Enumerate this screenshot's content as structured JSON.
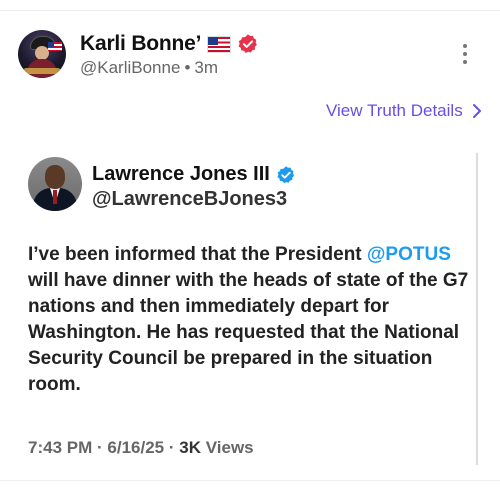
{
  "post": {
    "author_name": "Karli Bonne’",
    "handle": "@KarliBonne",
    "separator": "•",
    "time_ago": "3m",
    "view_details_label": "View Truth Details"
  },
  "embed": {
    "author_name": "Lawrence Jones III",
    "handle": "@LawrenceBJones3",
    "text_before_mention": "I’ve been informed that the President ",
    "mention": "@POTUS",
    "text_after_mention": " will have dinner with the heads of state of the G7 nations and then immediately depart for Washington. He has requested that the National Security Council be prepared in the situation room.",
    "time": "7:43 PM",
    "date": "6/16/25",
    "separator": "·",
    "views_count": "3K",
    "views_label": "Views"
  },
  "colors": {
    "accent_purple": "#6a4ee0",
    "mention_blue": "#1d9bf0",
    "verified_blue": "#1d9bf0",
    "verified_red": "#e5334b"
  },
  "icons": {
    "flag": "us-flag-icon",
    "verified_author": "verified-badge-icon",
    "verified_embed": "verified-badge-icon",
    "more": "more-vertical-icon",
    "chevron": "chevron-right-icon"
  }
}
